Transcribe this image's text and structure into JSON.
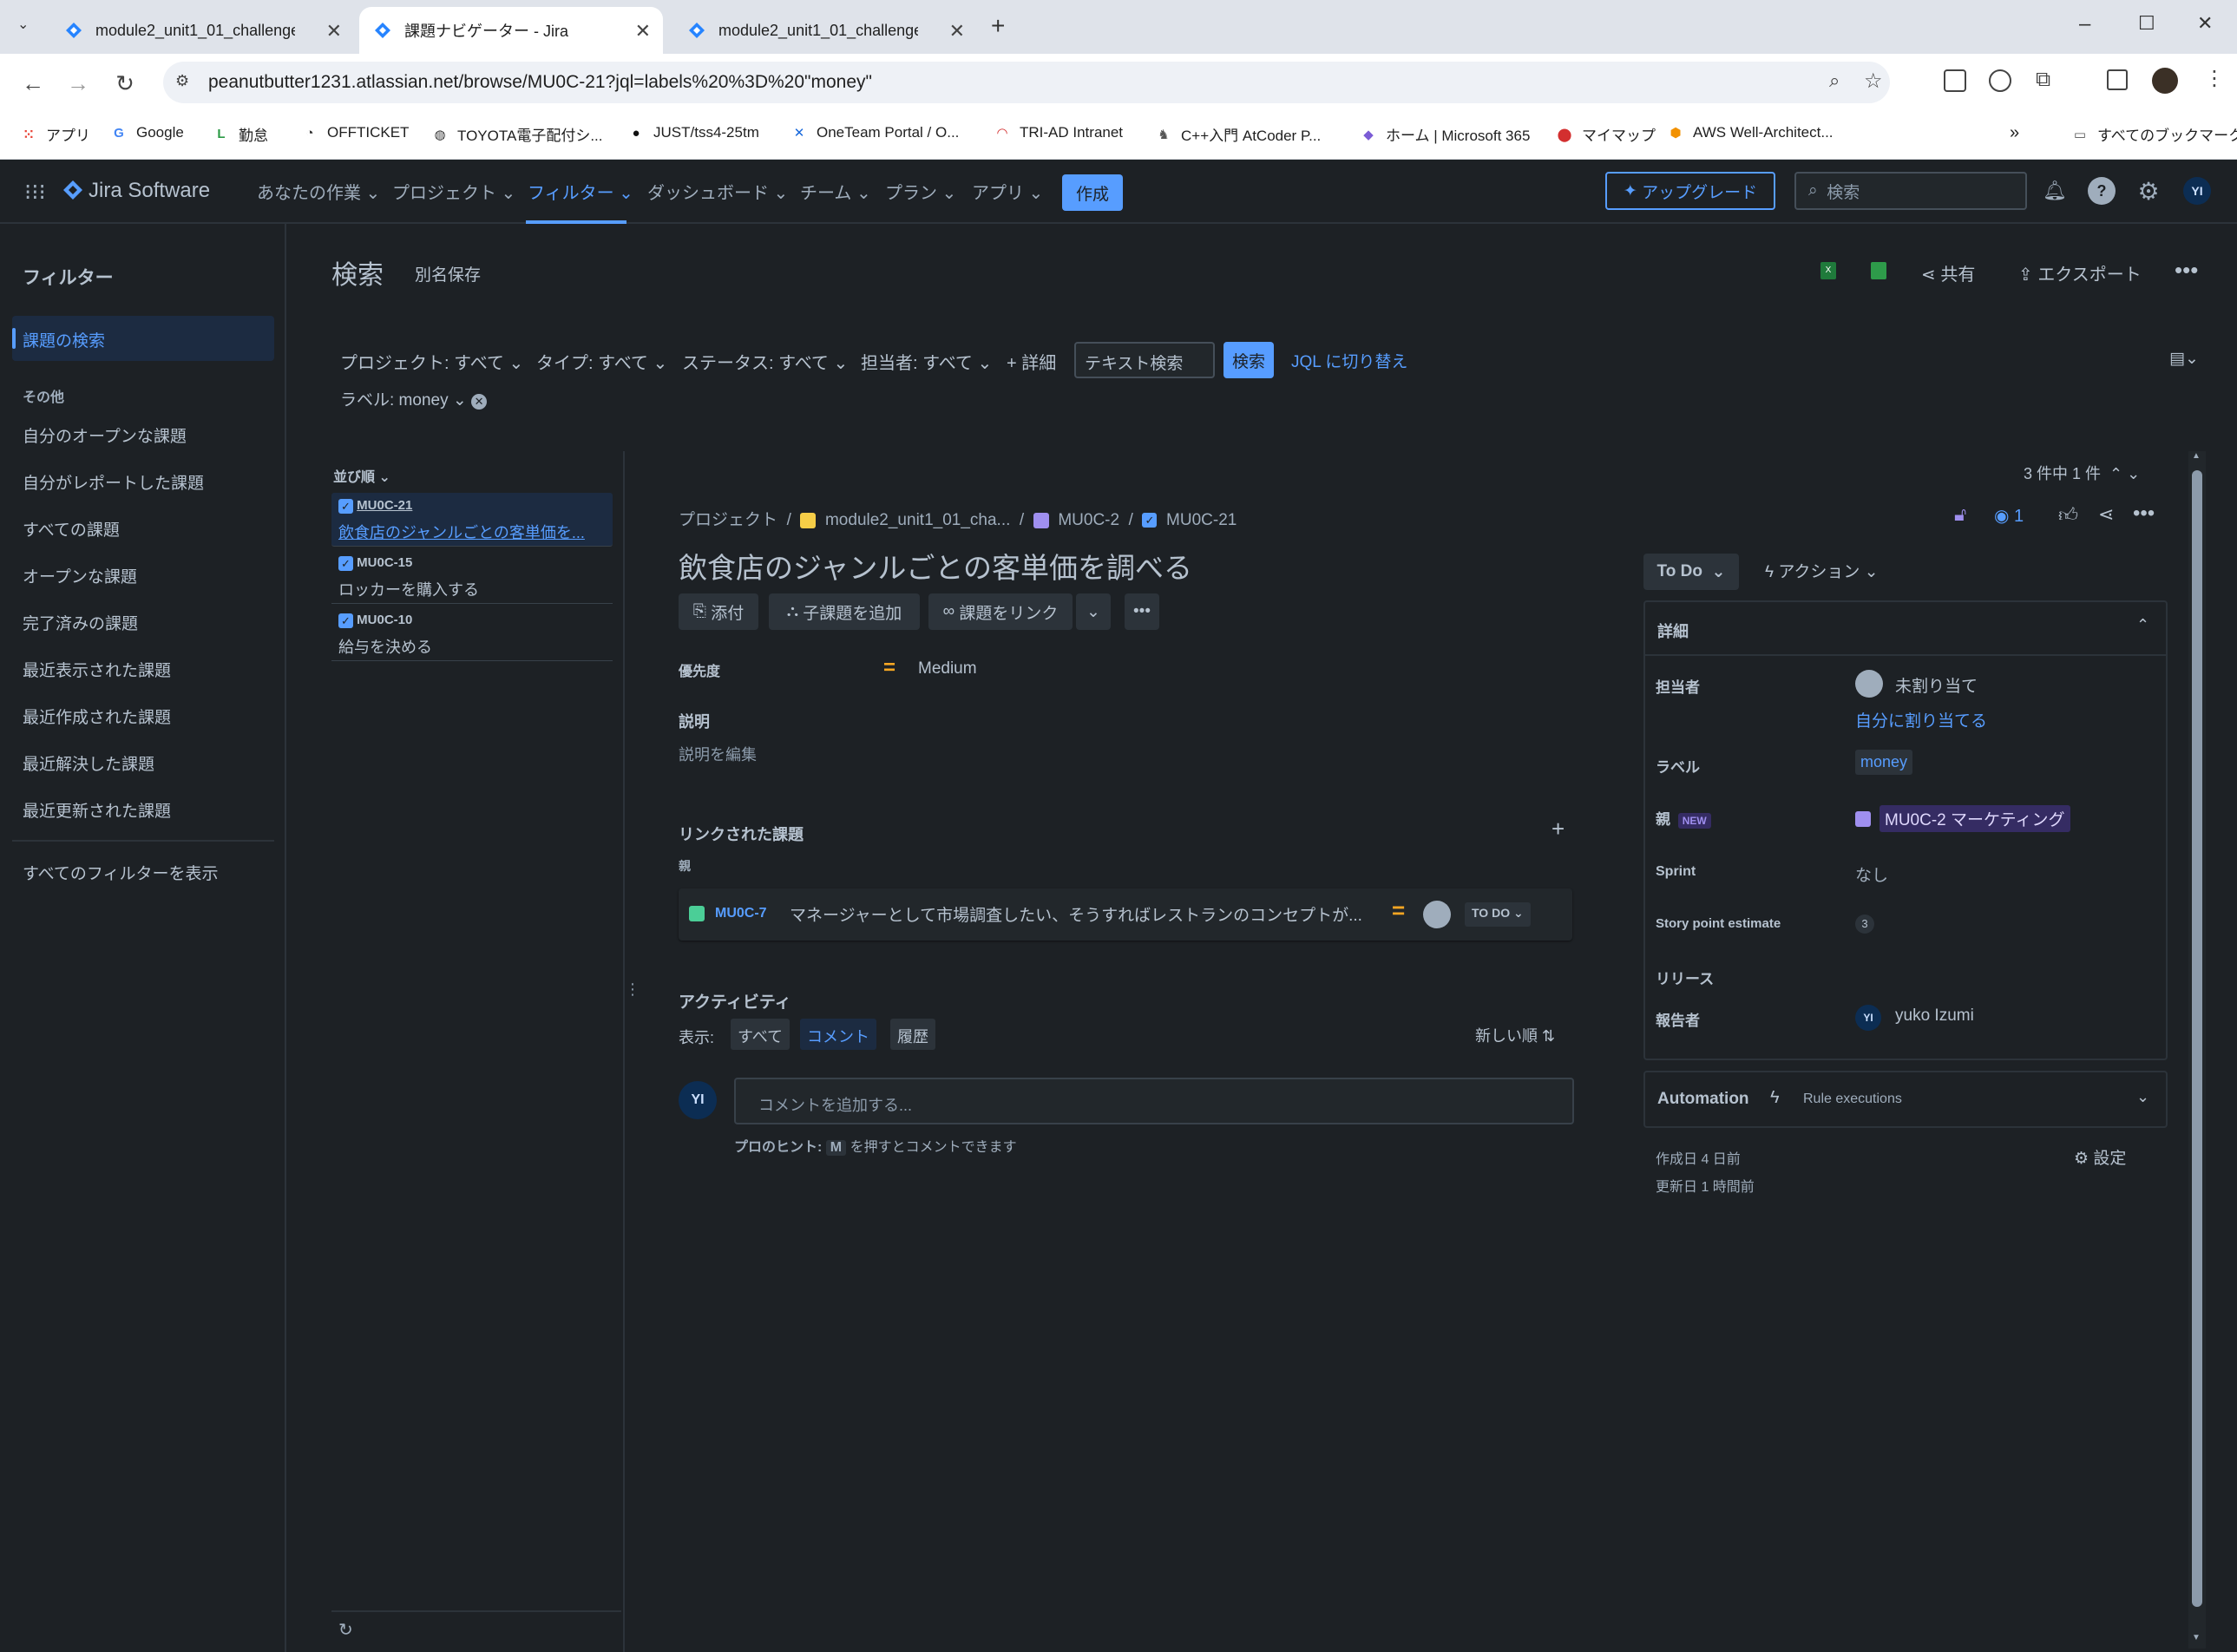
{
  "browser": {
    "tabs": [
      {
        "title": "module2_unit1_01_challenge -",
        "active": false
      },
      {
        "title": "課題ナビゲーター - Jira",
        "active": true
      },
      {
        "title": "module2_unit1_01_challenge -",
        "active": false
      }
    ],
    "url": "peanutbutter1231.atlassian.net/browse/MU0C-21?jql=labels%20%3D%20\"money\"",
    "bookmarks": [
      {
        "label": "アプリ",
        "icon": "apps-grid-icon"
      },
      {
        "label": "Google",
        "icon": "google-icon"
      },
      {
        "label": "勤怠",
        "icon": "attendance-icon"
      },
      {
        "label": "OFFTICKET",
        "icon": "offticket-icon"
      },
      {
        "label": "TOYOTA電子配付シ...",
        "icon": "globe-icon"
      },
      {
        "label": "JUST/tss4-25tm",
        "icon": "github-icon"
      },
      {
        "label": "OneTeam Portal / O...",
        "icon": "confluence-icon"
      },
      {
        "label": "TRI-AD Intranet",
        "icon": "intranet-icon"
      },
      {
        "label": "C++入門 AtCoder P...",
        "icon": "atcoder-icon"
      },
      {
        "label": "ホーム | Microsoft 365",
        "icon": "m365-icon"
      },
      {
        "label": "マイマップ",
        "icon": "map-pin-icon"
      },
      {
        "label": "AWS Well-Architect...",
        "icon": "aws-icon"
      }
    ],
    "all_bookmarks": "すべてのブックマーク"
  },
  "topnav": {
    "product": "Jira Software",
    "items": [
      "あなたの作業",
      "プロジェクト",
      "フィルター",
      "ダッシュボード",
      "チーム",
      "プラン",
      "アプリ"
    ],
    "create": "作成",
    "upgrade": "アップグレード",
    "search_placeholder": "検索",
    "avatar": "YI"
  },
  "sidebar": {
    "title": "フィルター",
    "selected": "課題の検索",
    "section": "その他",
    "items": [
      "自分のオープンな課題",
      "自分がレポートした課題",
      "すべての課題",
      "オープンな課題",
      "完了済みの課題",
      "最近表示された課題",
      "最近作成された課題",
      "最近解決した課題",
      "最近更新された課題"
    ],
    "view_all": "すべてのフィルターを表示"
  },
  "search": {
    "title": "検索",
    "save_as": "別名保存",
    "share": "共有",
    "export": "エクスポート",
    "filters": [
      "プロジェクト: すべて",
      "タイプ: すべて",
      "ステータス: すべて",
      "担当者: すべて"
    ],
    "more": "+ 詳細",
    "text_search": "テキスト検索",
    "search_button": "検索",
    "jql_switch": "JQL に切り替え",
    "label_filter": "ラベル: money",
    "sort": "並び順",
    "count": "3 件中 1 件"
  },
  "issue_list": [
    {
      "key": "MU0C-21",
      "summary": "飲食店のジャンルごとの客単価を..."
    },
    {
      "key": "MU0C-15",
      "summary": "ロッカーを購入する"
    },
    {
      "key": "MU0C-10",
      "summary": "給与を決める"
    }
  ],
  "issue": {
    "breadcrumb": [
      "プロジェクト",
      "module2_unit1_01_cha...",
      "MU0C-2",
      "MU0C-21"
    ],
    "watchers": "1",
    "title": "飲食店のジャンルごとの客単価を調べる",
    "actions": {
      "attach": "添付",
      "add_child": "子課題を追加",
      "link": "課題をリンク"
    },
    "priority_label": "優先度",
    "priority_value": "Medium",
    "description_label": "説明",
    "description_placeholder": "説明を編集",
    "linked_label": "リンクされた課題",
    "linked_type": "親",
    "linked_issue": {
      "key": "MU0C-7",
      "summary": "マネージャーとして市場調査したい、そうすればレストランのコンセプトが...",
      "status": "TO DO"
    },
    "activity": {
      "title": "アクティビティ",
      "show": "表示:",
      "tabs": [
        "すべて",
        "コメント",
        "履歴"
      ],
      "sort": "新しい順",
      "comment_placeholder": "コメントを追加する...",
      "avatar": "YI",
      "tip_prefix": "プロのヒント:",
      "tip_key": "M",
      "tip_suffix": "を押すとコメントできます"
    }
  },
  "details": {
    "status": "To Do",
    "action": "アクション",
    "header": "詳細",
    "assignee_label": "担当者",
    "assignee_value": "未割り当て",
    "assign_me": "自分に割り当てる",
    "labels_label": "ラベル",
    "labels_value": "money",
    "parent_label": "親",
    "parent_badge": "NEW",
    "parent_value": "MU0C-2 マーケティング",
    "sprint_label": "Sprint",
    "sprint_value": "なし",
    "sp_label": "Story point estimate",
    "sp_value": "3",
    "release_label": "リリース",
    "reporter_label": "報告者",
    "reporter_avatar": "YI",
    "reporter_value": "yuko Izumi",
    "automation": "Automation",
    "rule_exec": "Rule executions",
    "created": "作成日 4 日前",
    "updated": "更新日 1 時間前",
    "settings": "設定"
  },
  "colors": {
    "accent": "#579dff",
    "bg": "#1d2125",
    "medium_priority": "#f5a623"
  }
}
